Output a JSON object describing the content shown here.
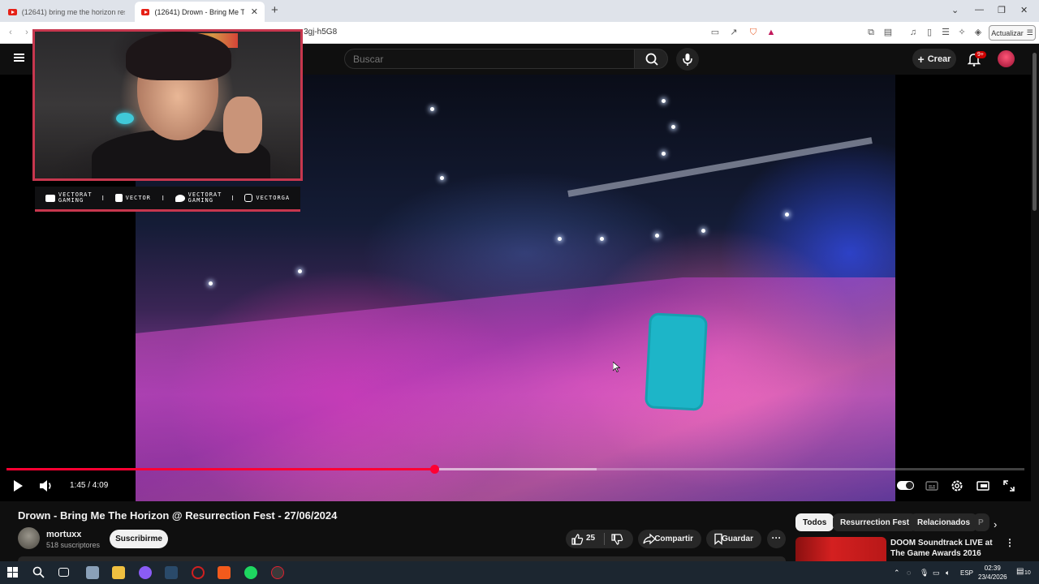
{
  "browser": {
    "tabs": [
      {
        "label": "(12641) bring me the horizon resurre",
        "active": false
      },
      {
        "label": "(12641) Drown - Bring Me The H",
        "active": true
      }
    ],
    "new_tab_label": "+",
    "url": "3gj-h5G8",
    "update_button": "Actualizar"
  },
  "youtube": {
    "search_placeholder": "Buscar",
    "create_label": "Crear",
    "notifications_badge": "9+"
  },
  "overlay": {
    "socials": [
      {
        "icon": "youtube-icon",
        "label": "VECTORAT GAMING"
      },
      {
        "icon": "twitch-icon",
        "label": "VECTOR"
      },
      {
        "icon": "twitter-icon",
        "label": "VECTORAT GAMING"
      },
      {
        "icon": "instagram-icon",
        "label": "VECTORGA"
      }
    ],
    "separator": "I"
  },
  "player": {
    "time": "1:45 / 4:09",
    "progress": 0.42,
    "buffered": 0.58
  },
  "video": {
    "title": "Drown - Bring Me The Horizon @ Resurrection Fest - 27/06/2024",
    "channel_name": "mortuxx",
    "subscribers": "518 suscriptores",
    "subscribe_label": "Suscribirme",
    "likes": "25",
    "share_label": "Compartir",
    "save_label": "Guardar",
    "more_label": "···"
  },
  "chips": [
    {
      "label": "Todos",
      "active": true
    },
    {
      "label": "Resurrection Fest",
      "active": false
    },
    {
      "label": "Relacionados",
      "active": false
    },
    {
      "label": "P",
      "active": false
    }
  ],
  "recommendation": {
    "title": "DOOM Soundtrack LIVE at The Game Awards 2016",
    "more": "⋮"
  },
  "taskbar": {
    "language": "ESP",
    "time": "02:39",
    "date": "23/4/2026",
    "notifications": "10"
  },
  "colors": {
    "accent": "#ff0033",
    "overlay_border": "#c7374e",
    "background": "#0f0f0f"
  }
}
